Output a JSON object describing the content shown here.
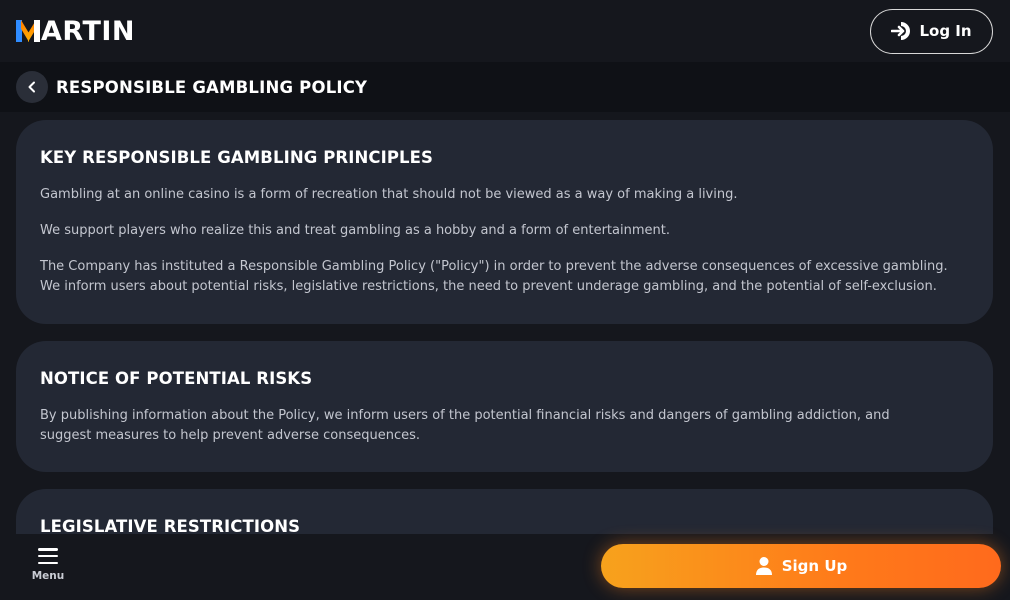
{
  "header": {
    "logo_text": "ARTIN",
    "login_label": "Log In"
  },
  "titlebar": {
    "title": "RESPONSIBLE GAMBLING POLICY"
  },
  "sections": [
    {
      "heading": "KEY RESPONSIBLE GAMBLING PRINCIPLES",
      "paragraphs": [
        "Gambling at an online casino is a form of recreation that should not be viewed as a way of making a living.",
        "We support players who realize this and treat gambling as a hobby and a form of entertainment.",
        "The Company has instituted a Responsible Gambling Policy (\"Policy\") in order to prevent the adverse consequences of excessive gambling. We inform users about potential risks, legislative restrictions, the need to prevent underage gambling, and the potential of self-exclusion."
      ]
    },
    {
      "heading": "NOTICE OF POTENTIAL RISKS",
      "paragraphs": [
        "By publishing information about the Policy, we inform users of the potential financial risks and dangers of gambling addiction, and suggest measures to help prevent adverse consequences."
      ]
    },
    {
      "heading": "LEGISLATIVE RESTRICTIONS",
      "paragraphs": []
    }
  ],
  "bottom": {
    "menu_label": "Menu",
    "signup_label": "Sign Up"
  },
  "colors": {
    "background": "#15171d",
    "card": "#232834",
    "accent_orange": "#ff7a1a",
    "logo_blue": "#2f8cff"
  }
}
